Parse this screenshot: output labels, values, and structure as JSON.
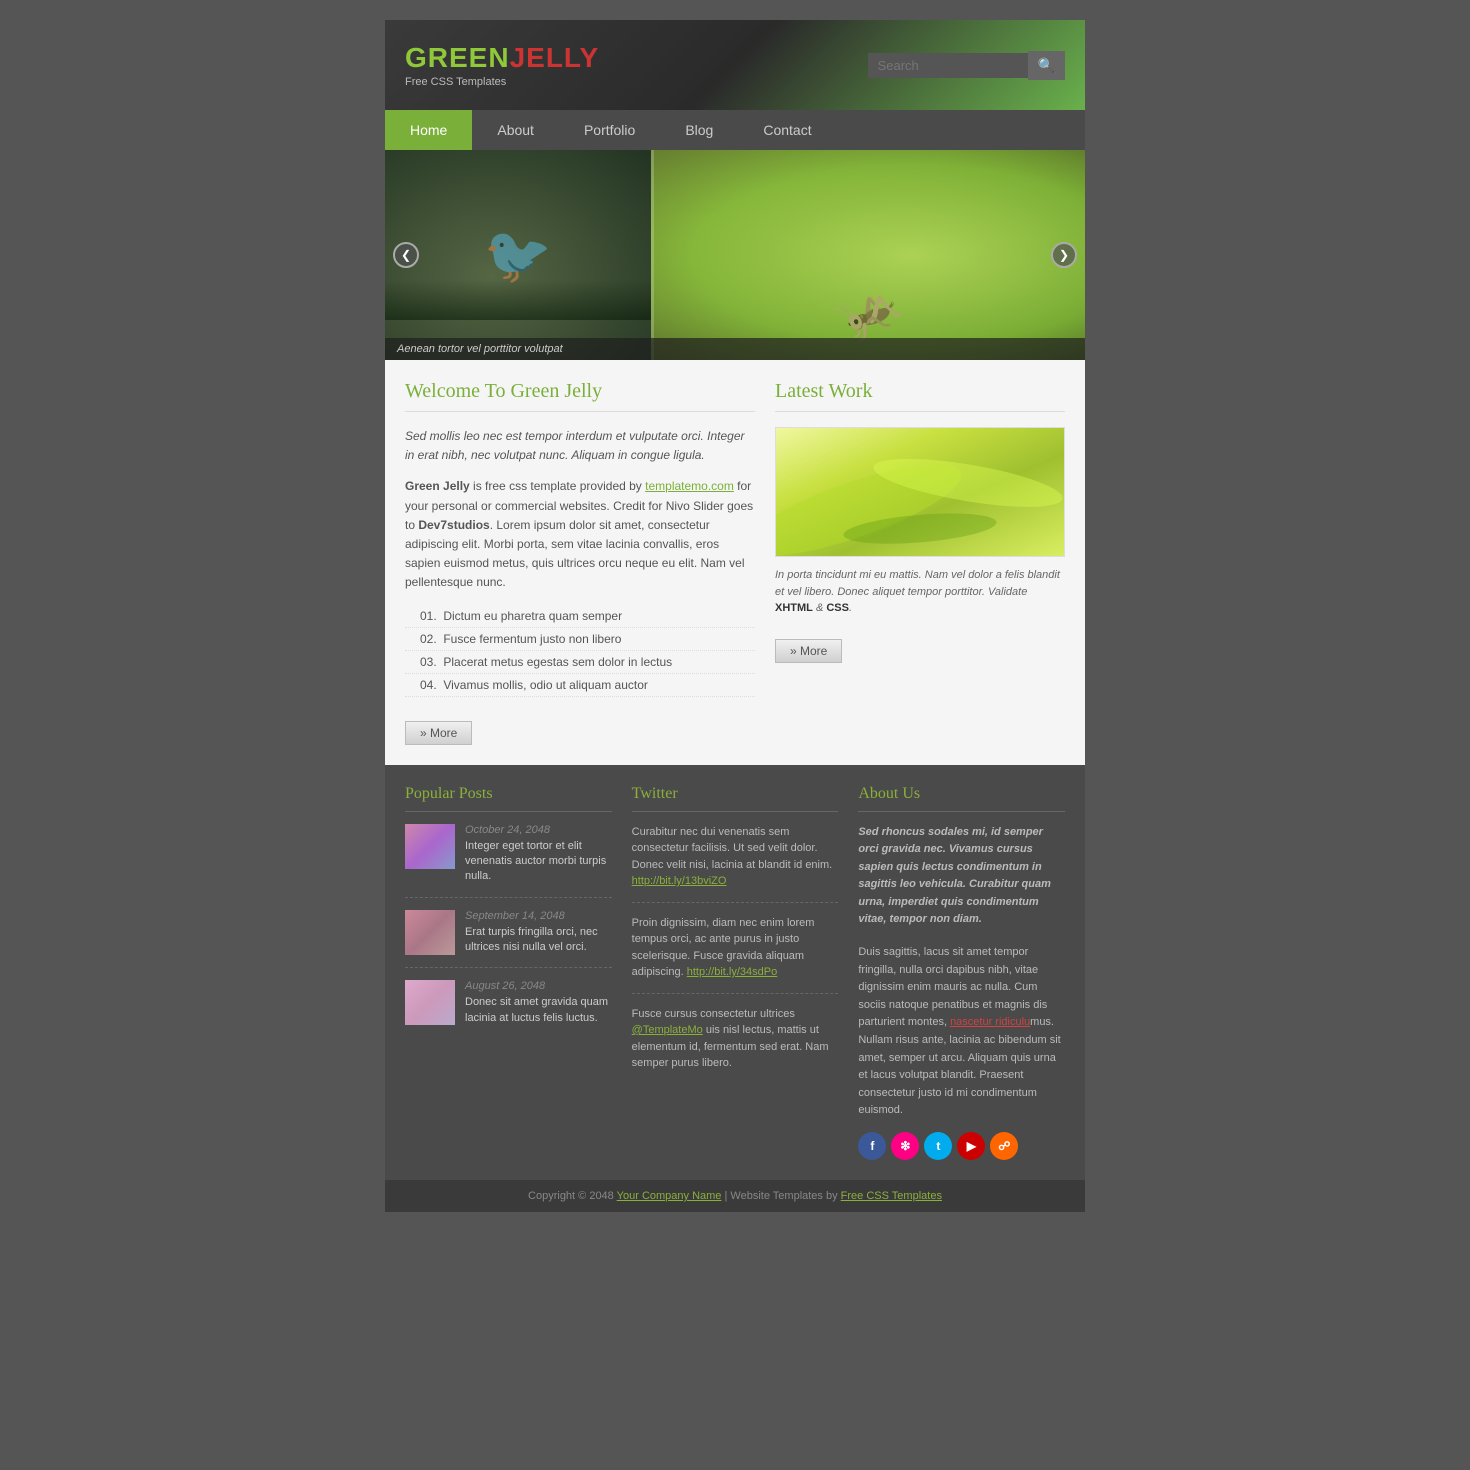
{
  "logo": {
    "green": "GREEN",
    "red": "JELLY",
    "tagline": "Free CSS Templates"
  },
  "search": {
    "placeholder": "Search",
    "button_label": "🔍"
  },
  "nav": {
    "items": [
      {
        "label": "Home",
        "active": true
      },
      {
        "label": "About"
      },
      {
        "label": "Portfolio"
      },
      {
        "label": "Blog"
      },
      {
        "label": "Contact"
      }
    ]
  },
  "slider": {
    "caption": "Aenean tortor vel porttitor volutpat"
  },
  "welcome": {
    "title": "Welcome To Green Jelly",
    "intro": "Sed mollis leo nec est tempor interdum et vulputate orci. Integer in erat nibh, nec volutpat nunc. Aliquam in congue ligula.",
    "body": "Green Jelly is free css template provided by templatemo.com for your personal or commercial websites. Credit for Nivo Slider goes to Dev7studios. Lorem ipsum dolor sit amet, consectetur adipiscing elit. Morbi porta, sem vitae lacinia convallis, eros sapien euismod metus, quis ultrices orcu neque eu elit. Nam vel pellentesque nunc.",
    "list": [
      "Dictum eu pharetra quam semper",
      "Fusce fermentum justo non libero",
      "Placerat metus egestas sem dolor in lectus",
      "Vivamus mollis, odio ut aliquam auctor"
    ],
    "more_btn": "More"
  },
  "latest_work": {
    "title": "Latest Work",
    "caption": "In porta tincidunt mi eu mattis. Nam vel dolor a felis blandit et vel libero. Donec aliquet tempor porttitor. Validate XHTML & CSS.",
    "xhtml_label": "XHTML",
    "css_label": "CSS",
    "more_btn": "More"
  },
  "popular_posts": {
    "title": "Popular Posts",
    "posts": [
      {
        "date": "October 24, 2048",
        "excerpt": "Integer eget tortor et elit venenatis auctor morbi turpis nulla.",
        "thumb": "t1"
      },
      {
        "date": "September 14, 2048",
        "excerpt": "Erat turpis fringilla orci, nec ultrices nisi nulla vel orci.",
        "thumb": "t2"
      },
      {
        "date": "August 26, 2048",
        "excerpt": "Donec sit amet gravida quam lacinia at luctus felis luctus.",
        "thumb": "t3"
      }
    ]
  },
  "twitter": {
    "title": "Twitter",
    "tweets": [
      {
        "text": "Curabitur nec dui venenatis sem consectetur facilisis. Ut sed velit dolor. Donec velit nisi, lacinia at blandit id enim.",
        "link": "http://bit.ly/13bviZO"
      },
      {
        "text": "Proin dignissim, diam nec enim lorem tempus orci, ac ante purus in justo scelerisque. Fusce gravida aliquam adipiscing.",
        "link": "http://bit.ly/34sdPo"
      },
      {
        "text": "Fusce cursus consectetur ultrices @TemplateMo uis nisl lectus, mattis ut elementum id, fermentum sed erat. Nam semper purus libero.",
        "link": null
      }
    ]
  },
  "about_us": {
    "title": "About Us",
    "text1": "Sed rhoncus sodales mi, id semper orci gravida nec. Vivamus cursus sapien quis lectus condimentum in sagittis leo vehicula. Curabitur quam urna, imperdiet quis condimentum vitae, tempor non diam.",
    "text2": "Duis sagittis, lacus sit amet tempor fringilla, nulla orci dapibus nibh, vitae dignissim enim mauris ac nulla. Cum sociis natoque penatibus et magnis dis parturient montes, nascetur ridiculu mus. Nullam risus ante, lacinia ac bibendum sit amet, semper ut arcu. Aliquam quis urna et lacus volutpat blandit. Praesent consectetur justo id mi condimentum euismod.",
    "link_text": "nascetur ridiculu",
    "social": [
      {
        "name": "Facebook",
        "class": "si-facebook",
        "label": "f"
      },
      {
        "name": "Flickr",
        "class": "si-flickr",
        "label": "F"
      },
      {
        "name": "Twitter",
        "class": "si-twitter",
        "label": "t"
      },
      {
        "name": "YouTube",
        "class": "si-youtube",
        "label": "▶"
      },
      {
        "name": "RSS",
        "class": "si-rss",
        "label": "R"
      }
    ]
  },
  "footer": {
    "copyright": "Copyright © 2048",
    "company": "Your Company Name",
    "separator": " | Website Templates by ",
    "link": "Free CSS Templates"
  }
}
